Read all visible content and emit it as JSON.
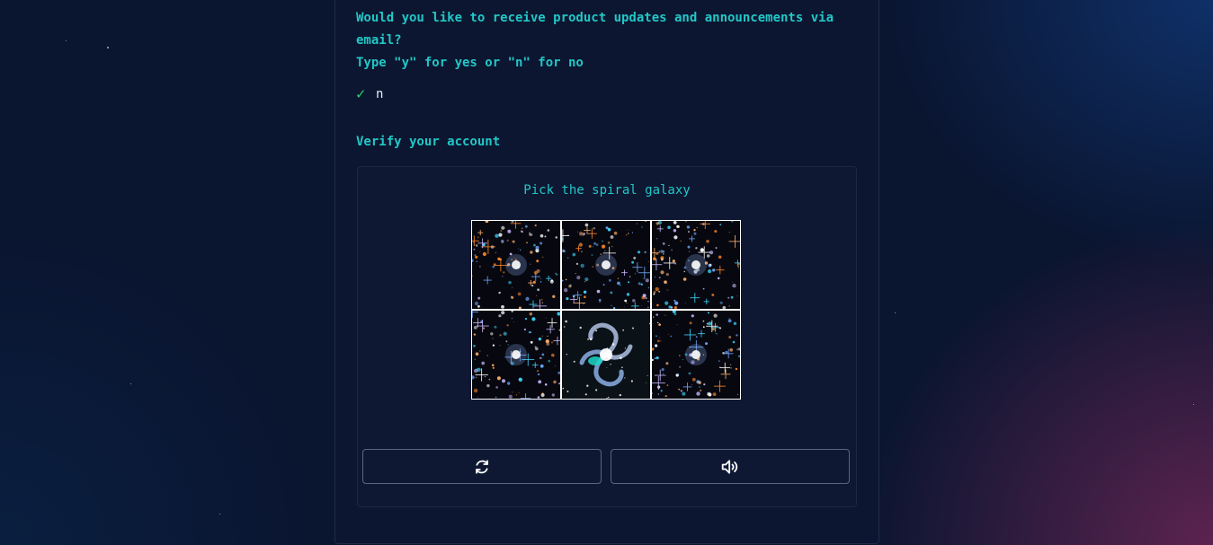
{
  "email_prompt": {
    "question_line1": "Would you like to receive product updates and announcements via",
    "question_line2": "email?",
    "instruction": "Type \"y\" for yes or \"n\" for no",
    "answer": "n",
    "answer_status_icon": "checkmark-icon"
  },
  "verification": {
    "title": "Verify your account",
    "captcha_prompt": "Pick the spiral galaxy",
    "tiles": [
      {
        "description": "starfield-image",
        "kind": "nebula"
      },
      {
        "description": "starfield-image",
        "kind": "nebula"
      },
      {
        "description": "starfield-image",
        "kind": "nebula"
      },
      {
        "description": "starfield-image",
        "kind": "nebula"
      },
      {
        "description": "spiral-galaxy-image",
        "kind": "spiral"
      },
      {
        "description": "starfield-image",
        "kind": "nebula"
      }
    ],
    "refresh_icon": "refresh-icon",
    "audio_icon": "speaker-icon"
  },
  "colors": {
    "accent": "#22c7c7",
    "check": "#2fcf6b",
    "background": "#0a1530",
    "panel": "#0c1630"
  }
}
